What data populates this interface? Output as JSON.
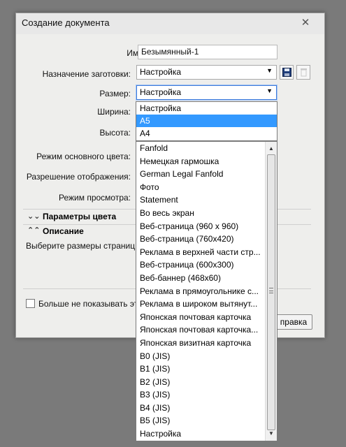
{
  "dialog": {
    "title": "Создание документа",
    "close_label": "✕"
  },
  "form": {
    "name_label": "Имя:",
    "name_value": "Безымянный-1",
    "preset_label": "Назначение заготовки:",
    "preset_value": "Настройка",
    "size_label": "Размер:",
    "size_value": "Настройка",
    "width_label": "Ширина:",
    "height_label": "Высота:",
    "color_mode_label": "Режим основного цвета:",
    "resolution_label": "Разрешение отображения:",
    "view_mode_label": "Режим просмотра:"
  },
  "sections": {
    "color_params": "Параметры цвета",
    "description": "Описание",
    "description_text": "Выберите размеры страниц д"
  },
  "footer": {
    "dont_show_label": "Больше не показывать эт",
    "help_button": "правка"
  },
  "size_dropdown_top": {
    "options": [
      "Настройка",
      "A5",
      "A4"
    ],
    "selected_index": 1
  },
  "size_dropdown_list": {
    "options": [
      "Fanfold",
      "Немецкая гармошка",
      "German Legal Fanfold",
      "Фото",
      "Statement",
      "Во весь экран",
      "Веб-страница (960 x 960)",
      "Веб-страница (760x420)",
      "Реклама в верхней части стр...",
      "Веб-страница (600x300)",
      "Веб-баннер (468x60)",
      "Реклама в прямоугольнике с...",
      "Реклама в широком вытянут...",
      "Японская почтовая карточка",
      "Японская почтовая карточка...",
      "Японская визитная карточка",
      "B0 (JIS)",
      "B1 (JIS)",
      "B2 (JIS)",
      "B3 (JIS)",
      "B4 (JIS)",
      "B5 (JIS)",
      "Настройка"
    ]
  },
  "colors": {
    "selection": "#3399ff",
    "focus_border": "#3d7bdb",
    "save_icon": "#1f3d7a"
  }
}
